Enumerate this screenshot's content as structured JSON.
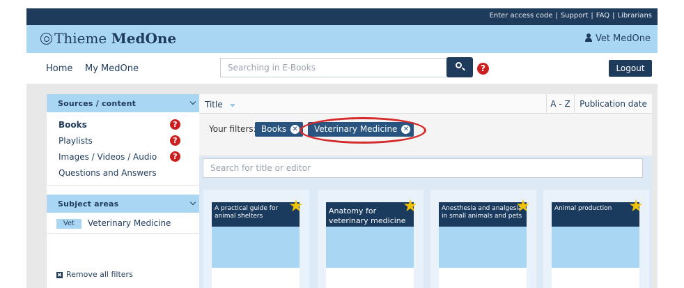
{
  "topbar": {
    "links": [
      "Enter access code",
      "Support",
      "FAQ",
      "Librarians"
    ],
    "separator": "|"
  },
  "brand": {
    "logo_regular": "Thieme ",
    "logo_bold": "MedOne",
    "user_label": "Vet MedOne"
  },
  "nav": {
    "home": "Home",
    "my_medone": "My MedOne",
    "search_placeholder": "Searching in E-Books",
    "help": "?",
    "logout": "Logout"
  },
  "sidebar": {
    "sources_header": "Sources / content",
    "items": [
      {
        "label": "Books",
        "active": true,
        "help": "?"
      },
      {
        "label": "Playlists",
        "active": false,
        "help": "?"
      },
      {
        "label": "Images / Videos / Audio",
        "active": false,
        "help": "?"
      },
      {
        "label": "Questions and Answers",
        "active": false
      }
    ],
    "subject_header": "Subject areas",
    "subject": {
      "badge": "Vet",
      "label": "Veterinary Medicine"
    },
    "remove_all": "Remove all filters",
    "remove_icon": "✖"
  },
  "main": {
    "sort_title": "Title",
    "sort_az": "A - Z",
    "sort_pubdate": "Publication date",
    "filters_label": "Your filters:",
    "filters": [
      {
        "label": "Books",
        "remove": "✕"
      },
      {
        "label": "Veterinary Medicine",
        "remove": "✕"
      }
    ],
    "title_search_placeholder": "Search for title or editor",
    "books": [
      {
        "title": "A practical guide for animal shelters",
        "favorite": "★"
      },
      {
        "title": "Anatomy for veterinary medicine",
        "favorite": "★"
      },
      {
        "title": "Anesthesia and analgesia in small animals and pets",
        "favorite": "★"
      },
      {
        "title": "Animal production",
        "favorite": "★"
      }
    ]
  },
  "colors": {
    "navy": "#1f3b5c",
    "light_blue": "#a9d6f3",
    "help_red": "#cc1f1f",
    "highlight_red": "#d42a2a",
    "star_yellow": "#f2c400"
  }
}
